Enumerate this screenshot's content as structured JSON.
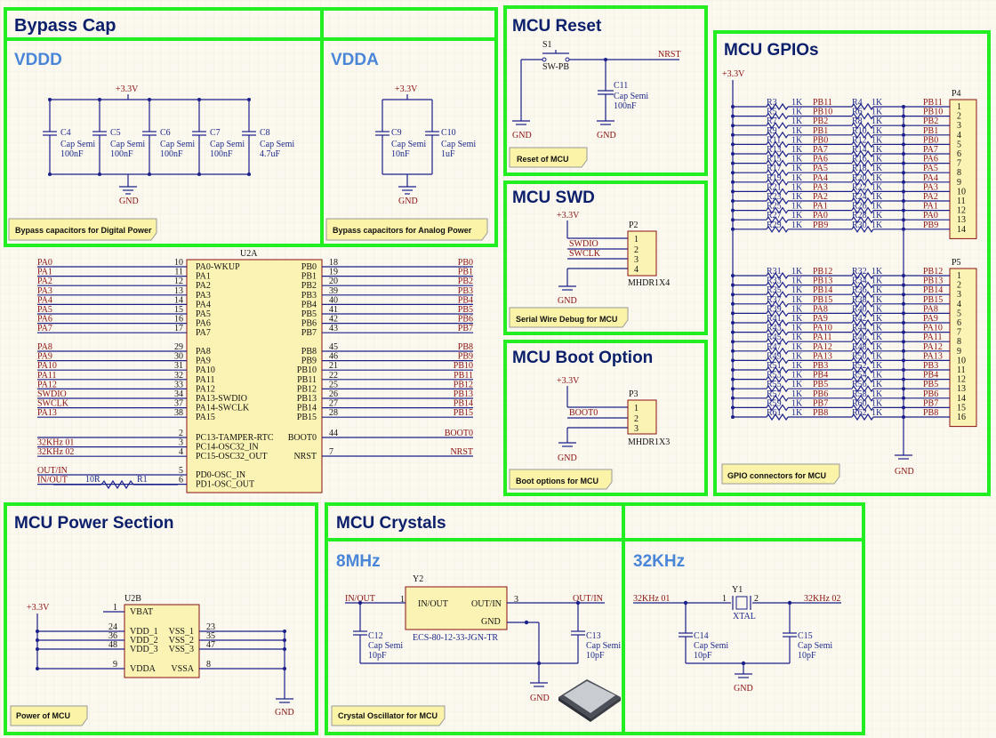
{
  "sections": {
    "bypass": {
      "title": "Bypass Cap",
      "vddd": "VDDD",
      "vdda": "VDDA",
      "note_digital": "Bypass capacitors for Digital Power",
      "note_analog": "Bypass capacitors for Analog Power"
    },
    "reset": {
      "title": "MCU Reset",
      "note": "Reset of MCU"
    },
    "swd": {
      "title": "MCU SWD",
      "note": "Serial Wire Debug for MCU"
    },
    "boot": {
      "title": "MCU Boot Option",
      "note": "Boot options for MCU"
    },
    "gpios": {
      "title": "MCU GPIOs",
      "note": "GPIO connectors for MCU"
    },
    "power": {
      "title": "MCU Power Section",
      "note": "Power of MCU"
    },
    "crystals": {
      "title": "MCU Crystals",
      "mhz": "8MHz",
      "khz": "32KHz",
      "note": "Crystal Oscillator for MCU"
    }
  },
  "common": {
    "vcc": "+3.3V",
    "gnd": "GND",
    "cap": "Cap Semi"
  },
  "bypass_caps_digital": [
    {
      "ref": "C4",
      "val": "100nF"
    },
    {
      "ref": "C5",
      "val": "100nF"
    },
    {
      "ref": "C6",
      "val": "100nF"
    },
    {
      "ref": "C7",
      "val": "100nF"
    },
    {
      "ref": "C8",
      "val": "4.7uF"
    }
  ],
  "bypass_caps_analog": [
    {
      "ref": "C9",
      "val": "10nF"
    },
    {
      "ref": "C10",
      "val": "1uF"
    }
  ],
  "reset_circuit": {
    "switch_ref": "S1",
    "switch_type": "SW-PB",
    "net": "NRST",
    "cap_ref": "C11",
    "cap_val": "100nF"
  },
  "swd_conn": {
    "ref": "P2",
    "type": "MHDR1X4",
    "pins": [
      "1",
      "2",
      "3",
      "4"
    ],
    "nets": [
      "SWDIO",
      "SWCLK"
    ]
  },
  "boot_conn": {
    "ref": "P3",
    "type": "MHDR1X3",
    "pins": [
      "1",
      "2",
      "3"
    ],
    "net": "BOOT0"
  },
  "mcu": {
    "ref": "U2A",
    "left_top": [
      {
        "net": "PA0",
        "pin": "10",
        "name": "PA0-WKUP"
      },
      {
        "net": "PA1",
        "pin": "11",
        "name": "PA1"
      },
      {
        "net": "PA2",
        "pin": "12",
        "name": "PA2"
      },
      {
        "net": "PA3",
        "pin": "13",
        "name": "PA3"
      },
      {
        "net": "PA4",
        "pin": "14",
        "name": "PA4"
      },
      {
        "net": "PA5",
        "pin": "15",
        "name": "PA5"
      },
      {
        "net": "PA6",
        "pin": "16",
        "name": "PA6"
      },
      {
        "net": "PA7",
        "pin": "17",
        "name": "PA7"
      }
    ],
    "left_mid": [
      {
        "net": "PA8",
        "pin": "29",
        "name": "PA8"
      },
      {
        "net": "PA9",
        "pin": "30",
        "name": "PA9"
      },
      {
        "net": "PA10",
        "pin": "31",
        "name": "PA10"
      },
      {
        "net": "PA11",
        "pin": "32",
        "name": "PA11"
      },
      {
        "net": "PA12",
        "pin": "33",
        "name": "PA12"
      },
      {
        "net": "SWDIO",
        "pin": "34",
        "name": "PA13-SWDIO"
      },
      {
        "net": "SWCLK",
        "pin": "37",
        "name": "PA14-SWCLK"
      },
      {
        "net": "PA13",
        "pin": "38",
        "name": "PA15"
      }
    ],
    "left_osc": [
      {
        "net": "",
        "pin": "2",
        "name": "PC13-TAMPER-RTC"
      },
      {
        "net": "32KHz 01",
        "pin": "3",
        "name": "PC14-OSC32_IN"
      },
      {
        "net": "32KHz 02",
        "pin": "4",
        "name": "PC15-OSC32_OUT"
      }
    ],
    "left_pd": [
      {
        "net": "OUT/IN",
        "pin": "5",
        "name": "PD0-OSC_IN"
      },
      {
        "net": "IN/OUT",
        "pin": "6",
        "name": "PD1-OSC_OUT"
      }
    ],
    "r1": {
      "ref": "R1",
      "val": "10R"
    },
    "right_top": [
      {
        "net": "PB0",
        "pin": "18",
        "name": "PB0"
      },
      {
        "net": "PB1",
        "pin": "19",
        "name": "PB1"
      },
      {
        "net": "PB2",
        "pin": "20",
        "name": "PB2"
      },
      {
        "net": "PB3",
        "pin": "39",
        "name": "PB3"
      },
      {
        "net": "PB4",
        "pin": "40",
        "name": "PB4"
      },
      {
        "net": "PB5",
        "pin": "41",
        "name": "PB5"
      },
      {
        "net": "PB6",
        "pin": "42",
        "name": "PB6"
      },
      {
        "net": "PB7",
        "pin": "43",
        "name": "PB7"
      }
    ],
    "right_mid": [
      {
        "net": "PB8",
        "pin": "45",
        "name": "PB8"
      },
      {
        "net": "PB9",
        "pin": "46",
        "name": "PB9"
      },
      {
        "net": "PB10",
        "pin": "21",
        "name": "PB10"
      },
      {
        "net": "PB11",
        "pin": "22",
        "name": "PB11"
      },
      {
        "net": "PB12",
        "pin": "25",
        "name": "PB12"
      },
      {
        "net": "PB13",
        "pin": "26",
        "name": "PB13"
      },
      {
        "net": "PB14",
        "pin": "27",
        "name": "PB14"
      },
      {
        "net": "PB15",
        "pin": "28",
        "name": "PB15"
      }
    ],
    "right_ctl": [
      {
        "net": "BOOT0",
        "pin": "44",
        "name": "BOOT0"
      },
      {
        "net": "NRST",
        "pin": "7",
        "name": "NRST"
      }
    ]
  },
  "gpio_p4": {
    "ref": "P4",
    "rows": [
      [
        "R3",
        "1K",
        "PB11",
        "R4",
        "1K"
      ],
      [
        "R5",
        "1K",
        "PB10",
        "R6",
        "1K"
      ],
      [
        "R7",
        "1K",
        "PB2",
        "R8",
        "1K"
      ],
      [
        "R9",
        "1K",
        "PB1",
        "R10",
        "1K"
      ],
      [
        "R11",
        "1K",
        "PB0",
        "R12",
        "1K"
      ],
      [
        "R13",
        "1K",
        "PA7",
        "R14",
        "1K"
      ],
      [
        "R15",
        "1K",
        "PA6",
        "R16",
        "1K"
      ],
      [
        "R17",
        "1K",
        "PA5",
        "R18",
        "1K"
      ],
      [
        "R19",
        "1K",
        "PA4",
        "R20",
        "1K"
      ],
      [
        "R21",
        "1K",
        "PA3",
        "R22",
        "1K"
      ],
      [
        "R23",
        "1K",
        "PA2",
        "R24",
        "1K"
      ],
      [
        "R25",
        "1K",
        "PA1",
        "R26",
        "1K"
      ],
      [
        "R27",
        "1K",
        "PA0",
        "R28",
        "1K"
      ],
      [
        "R29",
        "1K",
        "PB9",
        "R30",
        "1K"
      ]
    ]
  },
  "gpio_p5": {
    "ref": "P5",
    "rows": [
      [
        "R31",
        "1K",
        "PB12",
        "R32",
        "1K"
      ],
      [
        "R33",
        "1K",
        "PB13",
        "R34",
        "1K"
      ],
      [
        "R35",
        "1K",
        "PB14",
        "R36",
        "1K"
      ],
      [
        "R37",
        "1K",
        "PB15",
        "R38",
        "1K"
      ],
      [
        "R39",
        "1K",
        "PA8",
        "R40",
        "1K"
      ],
      [
        "R41",
        "1K",
        "PA9",
        "R42",
        "1K"
      ],
      [
        "R43",
        "1K",
        "PA10",
        "R44",
        "1K"
      ],
      [
        "R45",
        "1K",
        "PA11",
        "R46",
        "1K"
      ],
      [
        "R47",
        "1K",
        "PA12",
        "R48",
        "1K"
      ],
      [
        "R49",
        "1K",
        "PA13",
        "R50",
        "1K"
      ],
      [
        "R51",
        "1K",
        "PB3",
        "R52",
        "1K"
      ],
      [
        "R53",
        "1K",
        "PB4",
        "R54",
        "1K"
      ],
      [
        "R55",
        "1K",
        "PB5",
        "R56",
        "1K"
      ],
      [
        "R57",
        "1K",
        "PB6",
        "R58",
        "1K"
      ],
      [
        "R59",
        "1K",
        "PB7",
        "R60",
        "1K"
      ],
      [
        "R61",
        "1K",
        "PB8",
        "R62",
        "1K"
      ]
    ]
  },
  "power": {
    "ref": "U2B",
    "left": [
      {
        "pin": "1",
        "name": "VBAT"
      },
      {
        "pin": "24",
        "name": "VDD_1"
      },
      {
        "pin": "36",
        "name": "VDD_2"
      },
      {
        "pin": "48",
        "name": "VDD_3"
      },
      {
        "pin": "9",
        "name": "VDDA"
      }
    ],
    "right": [
      {
        "pin": "23",
        "name": "VSS_1"
      },
      {
        "pin": "35",
        "name": "VSS_2"
      },
      {
        "pin": "47",
        "name": "VSS_3"
      },
      {
        "pin": "8",
        "name": "VSSA"
      }
    ]
  },
  "osc8": {
    "ref": "Y2",
    "part": "ECS-80-12-33-JGN-TR",
    "in_pin": "1",
    "out_pin": "3",
    "in_label": "IN/OUT",
    "out_label": "OUT/IN",
    "pin_in": "IN/OUT",
    "pin_out": "OUT/IN",
    "pin_gnd": "GND",
    "caps": [
      {
        "ref": "C12",
        "val": "10pF"
      },
      {
        "ref": "C13",
        "val": "10pF"
      }
    ]
  },
  "osc32": {
    "ref": "Y1",
    "part": "XTAL",
    "pin1": "1",
    "pin2": "2",
    "left_label": "32KHz 01",
    "right_label": "32KHz 02",
    "caps": [
      {
        "ref": "C14",
        "val": "10pF"
      },
      {
        "ref": "C15",
        "val": "10pF"
      }
    ]
  }
}
